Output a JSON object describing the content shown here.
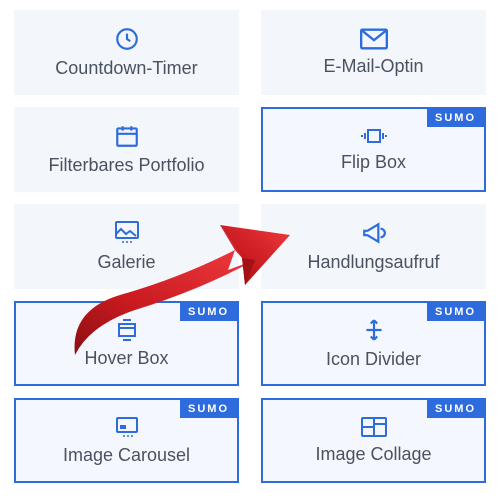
{
  "badge_label": "SUMO",
  "tiles": [
    {
      "label": "Countdown-Timer",
      "icon": "clock-icon",
      "sumo": false
    },
    {
      "label": "E-Mail-Optin",
      "icon": "mail-icon",
      "sumo": false
    },
    {
      "label": "Filterbares Portfolio",
      "icon": "calendar-icon",
      "sumo": false
    },
    {
      "label": "Flip Box",
      "icon": "flip-icon",
      "sumo": true
    },
    {
      "label": "Galerie",
      "icon": "gallery-icon",
      "sumo": false
    },
    {
      "label": "Handlungsaufruf",
      "icon": "megaphone-icon",
      "sumo": false
    },
    {
      "label": "Hover Box",
      "icon": "hover-icon",
      "sumo": true
    },
    {
      "label": "Icon Divider",
      "icon": "divider-icon",
      "sumo": true
    },
    {
      "label": "Image Carousel",
      "icon": "carousel-icon",
      "sumo": true
    },
    {
      "label": "Image Collage",
      "icon": "collage-icon",
      "sumo": true
    }
  ]
}
